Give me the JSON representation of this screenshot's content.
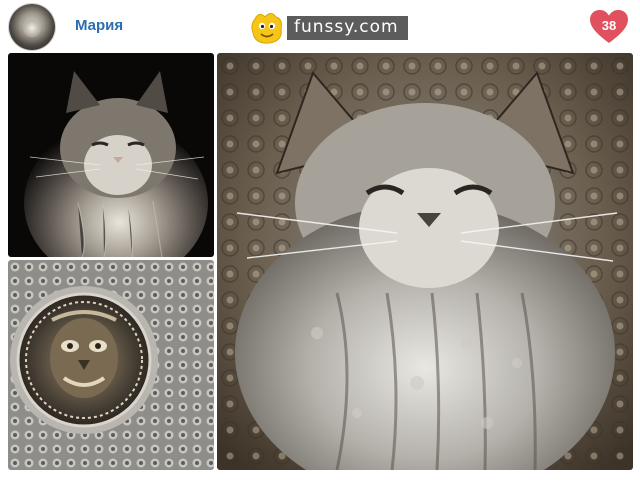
{
  "header": {
    "username": "Мария",
    "brand_text": "funssy.com",
    "like_count": "38"
  },
  "icons": {
    "avatar": "cat-avatar",
    "brand_mascot": "yellow-mascot-icon",
    "like": "heart-icon"
  },
  "colors": {
    "username": "#2a6fb0",
    "heart": "#e0505f",
    "brand_background": "#5c5c5c",
    "mascot": "#f5c518"
  },
  "gallery": {
    "photos": [
      "original-cat-photo",
      "deep-dream-mask-texture",
      "deep-dream-cat-result"
    ]
  }
}
